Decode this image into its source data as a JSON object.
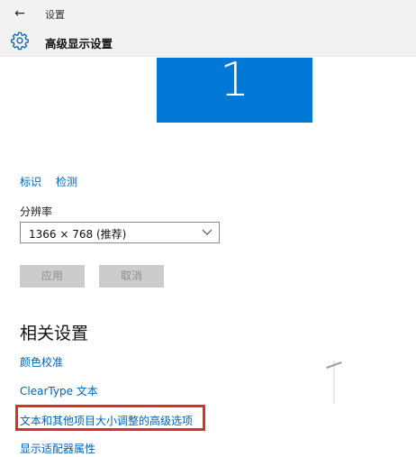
{
  "window": {
    "app_title": "设置",
    "back_label": "←"
  },
  "header": {
    "page_title": "高级显示设置"
  },
  "monitor": {
    "number": "1",
    "color": "#0078d7"
  },
  "display_links": {
    "identify": "标识",
    "detect": "检测"
  },
  "resolution": {
    "label": "分辨率",
    "value": "1366 × 768 (推荐)"
  },
  "buttons": {
    "apply": "应用",
    "cancel": "取消"
  },
  "related": {
    "title": "相关设置",
    "items": [
      "颜色校准",
      "ClearType 文本",
      "文本和其他项目大小调整的高级选项",
      "显示适配器属性"
    ]
  },
  "colors": {
    "link": "#0063b1",
    "highlight": "#d9322d",
    "button_disabled": "#cccccc"
  }
}
